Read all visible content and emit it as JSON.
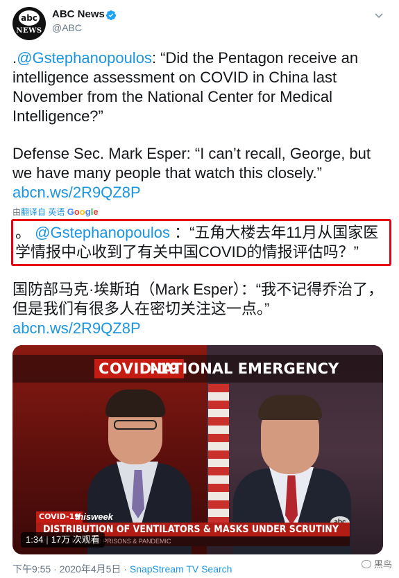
{
  "account": {
    "name": "ABC News",
    "handle": "@ABC",
    "avatar_top": "abc",
    "avatar_bottom": "NEWS"
  },
  "icons": {
    "verified": "verified-badge-icon",
    "menu": "chevron-down-icon"
  },
  "tweet": {
    "prefix": ".",
    "mention": "@Gstephanopoulos",
    "question": ": “Did the Pentagon receive an intelligence assessment on COVID in China last November from the National Center for Medical Intelligence?”",
    "answer": "Defense Sec. Mark Esper: “I can’t recall, George, but we have many people that watch this closely.”",
    "link": "abcn.ws/2R9QZ8P"
  },
  "translation": {
    "by_prefix": "由",
    "by_action": "翻译自 英语",
    "google_g": "G",
    "google_o1": "o",
    "google_o2": "o",
    "google_g2": "g",
    "google_l": "l",
    "google_e": "e",
    "prefix": "。",
    "mention": "@Gstephanopoulos",
    "question": "：“五角大楼去年11月从国家医学情报中心收到了有关中国COVID的情报评估吗？”",
    "answer": "国防部马克·埃斯珀（Mark Esper）：“我不记得乔治了，但是我们有很多人在密切关注这一点。”",
    "link": "abcn.ws/2R9QZ8P"
  },
  "video": {
    "covid_tag": "COVID-19",
    "banner": "NATIONAL EMERGENCY",
    "lower_tag": "COVID-19",
    "show": "thisweek",
    "headline": "DISTRIBUTION OF VENTILATORS & MASKS UNDER SCRUTINY",
    "bug": "abc",
    "ticker": "LIVE                IMPACT ON 2020                PRISONS & PANDEMIC",
    "duration": "1:34",
    "views": "17万 次观看"
  },
  "footer": {
    "time": "下午9:55 · 2020年4月5日 · ",
    "source": "SnapStream TV Search"
  },
  "watermark": "黑鸟"
}
